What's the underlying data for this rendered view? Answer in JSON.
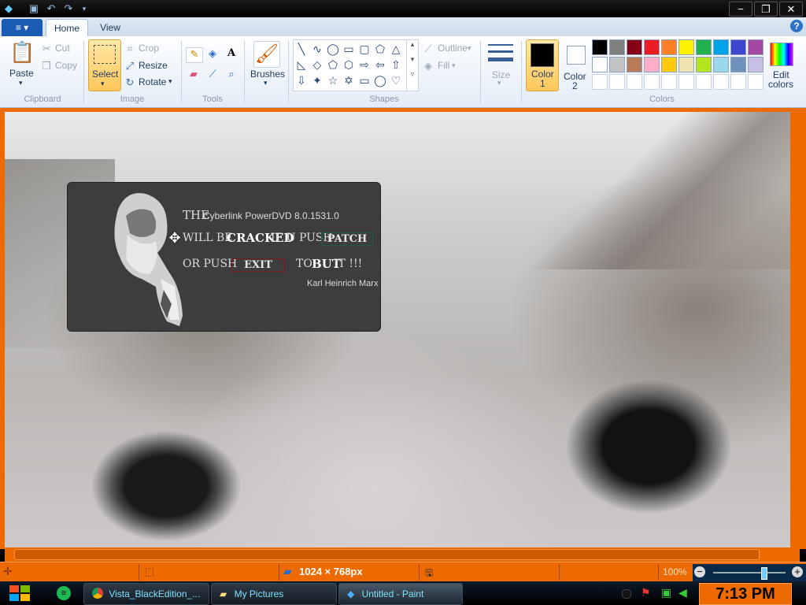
{
  "window": {
    "title_buttons": [
      "save-icon",
      "undo-icon",
      "redo-icon",
      "customize-icon"
    ],
    "minimize": "−",
    "maximize": "❐",
    "close": "✕"
  },
  "tabs": {
    "menu": "≡ ▾",
    "home": "Home",
    "view": "View",
    "help": "?"
  },
  "clipboard": {
    "paste": "Paste",
    "cut": "Cut",
    "copy": "Copy",
    "label": "Clipboard"
  },
  "image": {
    "select": "Select",
    "crop": "Crop",
    "resize": "Resize",
    "rotate": "Rotate",
    "label": "Image"
  },
  "tools": {
    "label": "Tools"
  },
  "brushes": {
    "label": "Brushes"
  },
  "shapes": {
    "outline": "Outline",
    "fill": "Fill",
    "label": "Shapes"
  },
  "size": {
    "label": "Size"
  },
  "colors": {
    "color1": "Color",
    "color1_num": "1",
    "color2": "Color",
    "color2_num": "2",
    "edit1": "Edit",
    "edit2": "colors",
    "label": "Colors",
    "palette_row1": [
      "#000000",
      "#7f7f7f",
      "#880015",
      "#ed1c24",
      "#ff7f27",
      "#fff200",
      "#22b14c",
      "#00a2e8",
      "#3f48cc",
      "#a349a4"
    ],
    "palette_row2": [
      "#ffffff",
      "#c3c3c3",
      "#b97a57",
      "#ffaec9",
      "#ffc90e",
      "#efe4b0",
      "#b5e61d",
      "#99d9ea",
      "#7092be",
      "#c8bfe7"
    ],
    "color1_value": "#000000",
    "color2_value": "#ffffff"
  },
  "popup": {
    "line1_a": "THE",
    "line1_b": "Cyberlink PowerDVD 8.0.1531.0",
    "line2_a": "WILL BE",
    "line2_b": "CRACKED",
    "line2_c": "IF U PUSH",
    "patch_button": "PATCH",
    "line3_a": "OR PUSH",
    "exit_button": "EXIT",
    "line3_b": "TO",
    "line3_c": "BUT",
    "line3_d": "IT  !!!",
    "signature": "Karl Heinrich Marx"
  },
  "statusbar": {
    "dimensions": "1024 × 768px",
    "zoom": "100%",
    "zoom_fraction": 0.7
  },
  "taskbar": {
    "tasks": [
      {
        "label": "Vista_BlackEdition_..."
      },
      {
        "label": "My Pictures"
      },
      {
        "label": "Untitled - Paint"
      }
    ],
    "clock": "7:13 PM"
  }
}
